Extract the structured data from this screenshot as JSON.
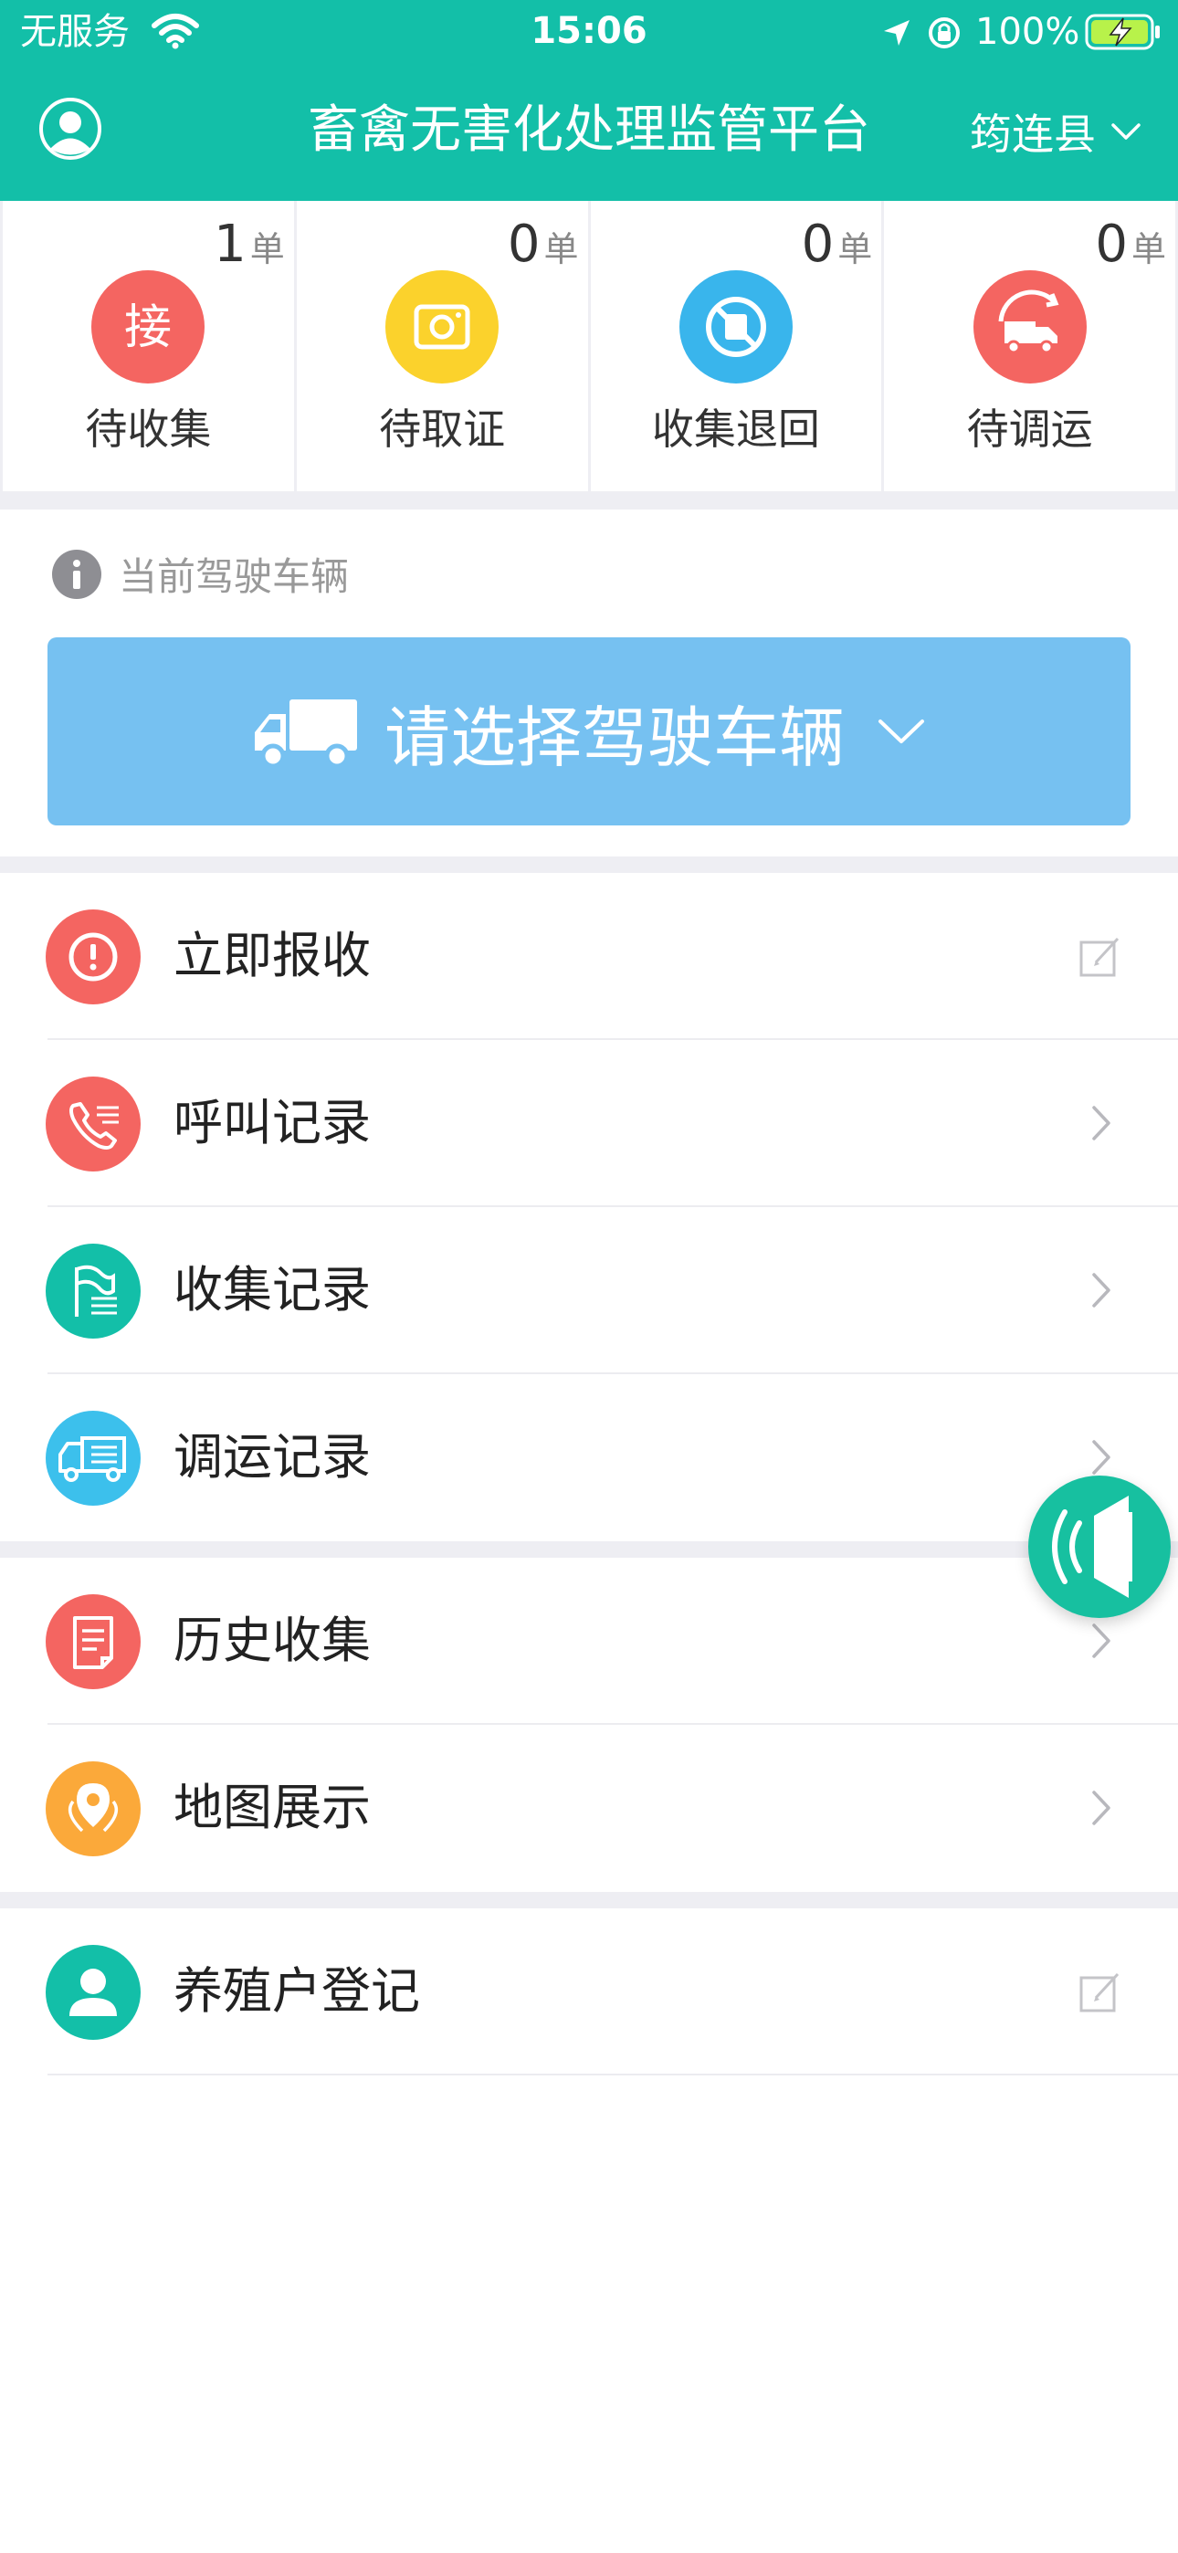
{
  "status_bar": {
    "carrier": "无服务",
    "time": "15:06",
    "battery": "100%"
  },
  "nav": {
    "title": "畜禽无害化处理监管平台",
    "region": "筠连县"
  },
  "summary": [
    {
      "count": "1",
      "unit": "单",
      "label": "待收集",
      "icon": "receive-icon",
      "color": "#f46561"
    },
    {
      "count": "0",
      "unit": "单",
      "label": "待取证",
      "icon": "camera-icon",
      "color": "#fbd22c"
    },
    {
      "count": "0",
      "unit": "单",
      "label": "收集退回",
      "icon": "return-icon",
      "color": "#39b5ec"
    },
    {
      "count": "0",
      "unit": "单",
      "label": "待调运",
      "icon": "truck-return-icon",
      "color": "#f46561"
    }
  ],
  "vehicle": {
    "hint": "当前驾驶车辆",
    "select_label": "请选择驾驶车辆"
  },
  "menu": {
    "group1": [
      {
        "label": "立即报收",
        "icon": "alert-icon",
        "color": "#f46561",
        "right": "edit"
      },
      {
        "label": "呼叫记录",
        "icon": "phone-icon",
        "color": "#f46561",
        "right": "chevron"
      },
      {
        "label": "收集记录",
        "icon": "flag-icon",
        "color": "#13bfa8",
        "right": "chevron"
      },
      {
        "label": "调运记录",
        "icon": "transport-icon",
        "color": "#3cc0ec",
        "right": "chevron"
      }
    ],
    "group2": [
      {
        "label": "历史收集",
        "icon": "document-icon",
        "color": "#f46561",
        "right": "chevron"
      },
      {
        "label": "地图展示",
        "icon": "map-pin-icon",
        "color": "#fba93a",
        "right": "chevron"
      }
    ],
    "group3": [
      {
        "label": "养殖户登记",
        "icon": "user-icon",
        "color": "#13bfa8",
        "right": "edit"
      }
    ]
  },
  "colors": {
    "primary": "#13bfa8",
    "vehicle_button": "#76c1f1",
    "background_gray": "#eeeef3"
  }
}
